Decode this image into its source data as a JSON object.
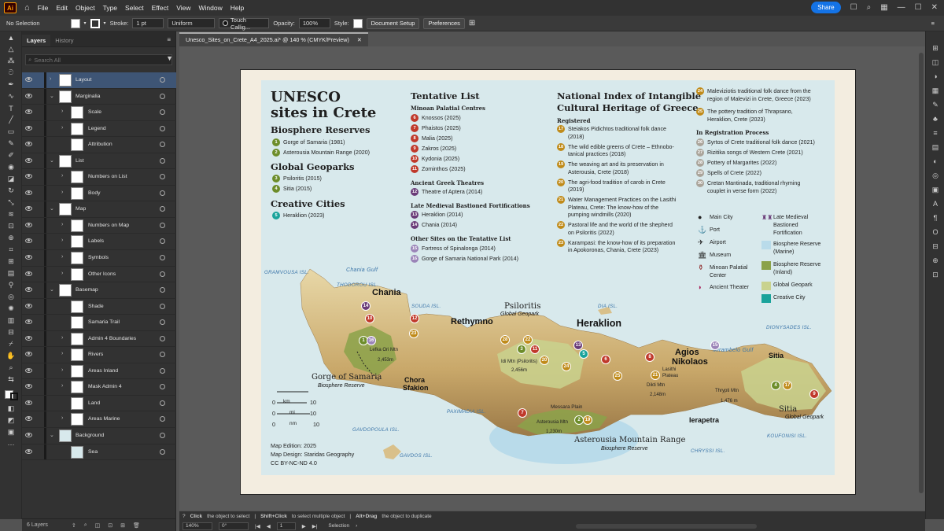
{
  "app": {
    "logo": "Ai",
    "menus": [
      "File",
      "Edit",
      "Object",
      "Type",
      "Select",
      "Effect",
      "View",
      "Window",
      "Help"
    ],
    "share": "Share"
  },
  "control": {
    "selection": "No Selection",
    "stroke_label": "Stroke:",
    "stroke_value": "1 pt",
    "uniform": "Uniform",
    "brush": "Touch Callig...",
    "opacity_label": "Opacity:",
    "opacity_value": "100%",
    "style_label": "Style:",
    "doc_setup": "Document Setup",
    "preferences": "Preferences"
  },
  "panel": {
    "tabs": [
      "Layers",
      "History"
    ],
    "search": "Search All",
    "count": "6 Layers",
    "layers": [
      "Layout",
      "Marginalia",
      "Scale",
      "Legend",
      "Attribution",
      "List",
      "Numbers on List",
      "Body",
      "Map",
      "Numbers on Map",
      "Labels",
      "Symbols",
      "Other Icons",
      "Basemap",
      "Shade",
      "Samaria Trail",
      "Admin 4 Boundaries",
      "Rivers",
      "Areas Inland",
      "Mask Admin 4",
      "Land",
      "Areas Marine",
      "Background",
      "Sea"
    ]
  },
  "document": {
    "tab": "Unesco_Sites_on_Crete_A4_2025.ai* @ 140 % (CMYK/Preview)"
  },
  "status": {
    "zoom": "140%",
    "rotate": "0°",
    "page": "1",
    "mode": "Selection",
    "hint1_b": "Click",
    "hint1": "the object to select",
    "hint2_b": "Shift+Click",
    "hint2": "to select multiple object",
    "hint3_b": "Alt+Drag",
    "hint3": "the object to duplicate"
  },
  "map": {
    "title1": "UNESCO",
    "title2": "sites in Crete",
    "bio_h": "Biosphere Reserves",
    "bio": [
      {
        "n": "1",
        "t": "Gorge of Samaria (1981)"
      },
      {
        "n": "2",
        "t": "Asterousia Mountain Range (2020)"
      }
    ],
    "geo_h": "Global Geoparks",
    "geo": [
      {
        "n": "3",
        "t": "Psiloritis (2015)"
      },
      {
        "n": "4",
        "t": "Sitia (2015)"
      }
    ],
    "cc_h": "Creative Cities",
    "cc": [
      {
        "n": "5",
        "t": "Heraklion (2023)"
      }
    ],
    "tent_h": "Tentative List",
    "min_h": "Minoan Palatial Centres",
    "min": [
      {
        "n": "6",
        "t": "Knossos (2025)"
      },
      {
        "n": "7",
        "t": "Phaistos (2025)"
      },
      {
        "n": "8",
        "t": "Malia (2025)"
      },
      {
        "n": "9",
        "t": "Zakros (2025)"
      },
      {
        "n": "10",
        "t": "Kydonia (2025)"
      },
      {
        "n": "11",
        "t": "Zominthos (2025)"
      }
    ],
    "gr_h": "Ancient Greek Theatres",
    "gr": [
      {
        "n": "12",
        "t": "Theatre of Aptera (2014)"
      }
    ],
    "lm_h": "Late Medieval Bastioned Fortifications",
    "lm": [
      {
        "n": "13",
        "t": "Heraklion (2014)"
      },
      {
        "n": "14",
        "t": "Chania (2014)"
      }
    ],
    "oth_h": "Other Sites on the Tentative List",
    "oth": [
      {
        "n": "15",
        "t": "Fortress of Spinalonga (2014)"
      },
      {
        "n": "16",
        "t": "Gorge of Samaria National Park (2014)"
      }
    ],
    "ni_h1": "National Index of Intangible",
    "ni_h2": "Cultural Heritage of Greece",
    "reg_h": "Registered",
    "reg": [
      {
        "n": "17",
        "t1": "Steiakos Pidichtos traditional folk dance",
        "t2": "(2018)"
      },
      {
        "n": "18",
        "t1": "The wild edible greens of Crete – Ethnobo-",
        "t2": "tanical practices (2018)"
      },
      {
        "n": "19",
        "t1": "The weaving art and its preservation in",
        "t2": "Asterousia, Crete (2018)"
      },
      {
        "n": "20",
        "t1": "The agri-food tradition of carob in Crete",
        "t2": "(2019)"
      },
      {
        "n": "21",
        "t1": "Water Management Practices on the Lasithi",
        "t2": "Plateau, Crete: The know-how of the",
        "t3": "pumping windmills (2020)"
      },
      {
        "n": "22",
        "t1": "Pastoral life and the world of the shepherd",
        "t2": "on Psiloritis (2022)"
      },
      {
        "n": "23",
        "t1": "Karampasi: the know-how of its preparation",
        "t2": "in Apokoronas, Chania, Crete (2023)"
      }
    ],
    "reg2": [
      {
        "n": "24",
        "t1": "Maleviziotis traditional folk dance from the",
        "t2": "region of Malevizi in Crete, Greece (2023)"
      },
      {
        "n": "25",
        "t1": "The pottery tradition of Thrapsano,",
        "t2": "Heraklion, Crete (2023)"
      }
    ],
    "irp_h": "In Registration Process",
    "irp": [
      {
        "n": "26",
        "t1": "Syrtos of Crete traditional folk dance (2021)"
      },
      {
        "n": "27",
        "t1": "Rizitika songs of Western Crete (2021)"
      },
      {
        "n": "28",
        "t1": "Pottery of Margarites (2022)"
      },
      {
        "n": "29",
        "t1": "Spells of Crete (2022)"
      },
      {
        "n": "30",
        "t1": "Cretan Mantinada, traditional rhyming",
        "t2": "couplet in verse form (2022)"
      }
    ],
    "legend": [
      {
        "t": "Main City",
        "icon": "main-city-icon"
      },
      {
        "t": "Port",
        "icon": "anchor-icon"
      },
      {
        "t": "Airport",
        "icon": "airport-icon"
      },
      {
        "t": "Museum",
        "icon": "museum-icon"
      },
      {
        "t": "Minoan Palatial",
        "t2": "Center",
        "icon": "vase-icon"
      },
      {
        "t": "Ancient Theater",
        "icon": "theater-icon"
      }
    ],
    "legend2": [
      {
        "t": "Late Medieval",
        "t2": "Bastioned",
        "t3": "Fortification",
        "color": "#6a3b78"
      },
      {
        "t": "Biosphere Reserve",
        "t2": "(Marine)",
        "color": "#b9dbea"
      },
      {
        "t": "Biosphere Reserve",
        "t2": "(Inland)",
        "color": "#8ba24a"
      },
      {
        "t": "Global Geopark",
        "color": "#c9d28e"
      },
      {
        "t": "Creative City",
        "color": "#1aa39b"
      }
    ],
    "places": {
      "chania": "Chania",
      "rethymno": "Rethymno",
      "heraklion": "Heraklion",
      "agios": "Agios",
      "nikolaos": "Nikolaos",
      "ierapetra": "Ierapetra",
      "sitia": "Sitia",
      "chora": "Chora",
      "sfakion": "Sfakion",
      "psiloritis": "Psiloritis",
      "gg1": "Global Geopark",
      "gorge": "Gorge of Samaria",
      "br1": "Biosphere Reserve",
      "aster": "Asterousia Mountain Range",
      "br2": "Biosphere Reserve",
      "sitia_gp": "Sitia",
      "gg2": "Global Geopark",
      "lefka": "Lefka Ori Mtn",
      "lefka_h": "2,453m",
      "idi": "Idi Mtn (Psiloritis)",
      "idi_h": "2,456m",
      "dikti": "Dikti Mtn",
      "dikti_h": "2,148m",
      "lasithi1": "Lasithi",
      "lasithi2": "Plateau",
      "thrypti": "Thrypti Mtn",
      "thrypti_h": "1,476 m",
      "asterm": "Asterousia Mtn",
      "asterm_h": "1,230m",
      "messara": "Messara Plain"
    },
    "sea": {
      "gramvousa": "GRAMVOUSA ISL.",
      "chania_gulf": "Chania Gulf",
      "thodorou": "THODOROU ISL.",
      "souda": "SOUDA ISL.",
      "dia": "DIA ISL.",
      "dionysades": "DIONYSADES ISL.",
      "mirambelo": "Mirambelo Gulf",
      "paximadia": "PAXIMADIA ISL.",
      "gavdopoula": "GAVDOPOULA ISL.",
      "gavdos": "GAVDOS ISL.",
      "chryssi": "CHRYSSI ISL.",
      "koufonisi": "KOUFONISI ISL."
    },
    "scale": {
      "km": "km",
      "mi": "mi",
      "nm": "nm",
      "zero": "0",
      "ten": "10"
    },
    "credits": [
      "Map Edition: 2025",
      "Map Design: Staridas Geography",
      "CC BY-NC-ND 4.0"
    ]
  }
}
